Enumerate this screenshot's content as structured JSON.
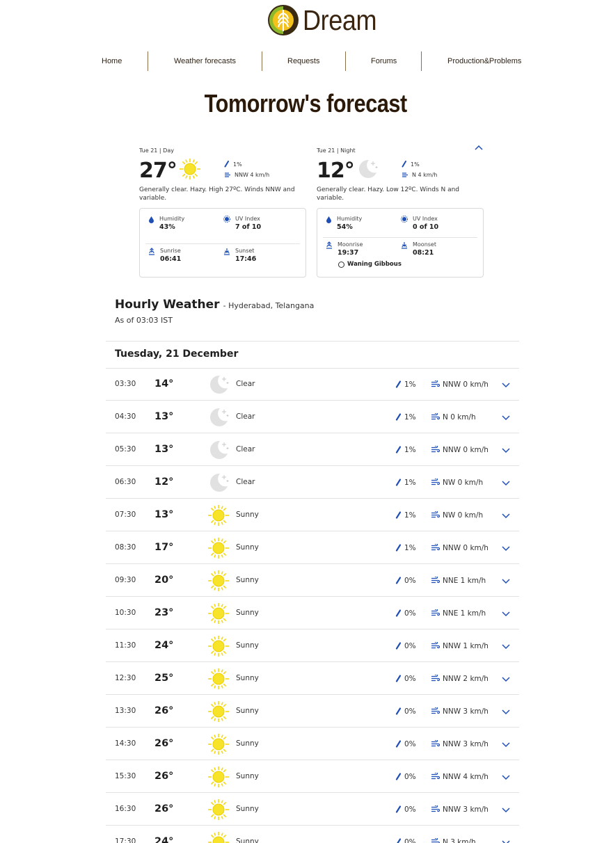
{
  "brand": {
    "name": "Dream"
  },
  "nav": {
    "items": [
      {
        "label": "Home"
      },
      {
        "label": "Weather forecasts"
      },
      {
        "label": "Requests"
      },
      {
        "label": "Forums"
      },
      {
        "label": "Production&Problems"
      }
    ]
  },
  "page": {
    "title": "Tomorrow's forecast"
  },
  "day": {
    "period": "Tue 21 | Day",
    "temp": "27°",
    "precip": "1%",
    "wind": "NNW 4 km/h",
    "description": "Generally clear. Hazy. High 27ºC. Winds NNW and variable.",
    "humidity_label": "Humidity",
    "humidity": "43%",
    "uv_label": "UV Index",
    "uv": "7 of 10",
    "sunrise_label": "Sunrise",
    "sunrise": "06:41",
    "sunset_label": "Sunset",
    "sunset": "17:46"
  },
  "night": {
    "period": "Tue 21 | Night",
    "temp": "12°",
    "precip": "1%",
    "wind": "N 4 km/h",
    "description": "Generally clear. Hazy. Low 12ºC. Winds N and variable.",
    "humidity_label": "Humidity",
    "humidity": "54%",
    "uv_label": "UV Index",
    "uv": "0 of 10",
    "moonrise_label": "Moonrise",
    "moonrise": "19:37",
    "moonset_label": "Moonset",
    "moonset": "08:21",
    "moon_phase": "Waning Gibbous"
  },
  "hourly": {
    "title": "Hourly Weather",
    "location": "- Hyderabad, Telangana",
    "as_of": "As of 03:03 IST",
    "day_label": "Tuesday, 21 December",
    "rows": [
      {
        "time": "03:30",
        "temp": "14°",
        "icon": "moon-icon",
        "condition": "Clear",
        "precip": "1%",
        "wind": "NNW 0 km/h"
      },
      {
        "time": "04:30",
        "temp": "13°",
        "icon": "moon-icon",
        "condition": "Clear",
        "precip": "1%",
        "wind": "N 0 km/h"
      },
      {
        "time": "05:30",
        "temp": "13°",
        "icon": "moon-icon",
        "condition": "Clear",
        "precip": "1%",
        "wind": "NNW 0 km/h"
      },
      {
        "time": "06:30",
        "temp": "12°",
        "icon": "moon-icon",
        "condition": "Clear",
        "precip": "1%",
        "wind": "NW 0 km/h"
      },
      {
        "time": "07:30",
        "temp": "13°",
        "icon": "sun-icon",
        "condition": "Sunny",
        "precip": "1%",
        "wind": "NW 0 km/h"
      },
      {
        "time": "08:30",
        "temp": "17°",
        "icon": "sun-icon",
        "condition": "Sunny",
        "precip": "1%",
        "wind": "NNW 0 km/h"
      },
      {
        "time": "09:30",
        "temp": "20°",
        "icon": "sun-icon",
        "condition": "Sunny",
        "precip": "0%",
        "wind": "NNE 1 km/h"
      },
      {
        "time": "10:30",
        "temp": "23°",
        "icon": "sun-icon",
        "condition": "Sunny",
        "precip": "0%",
        "wind": "NNE 1 km/h"
      },
      {
        "time": "11:30",
        "temp": "24°",
        "icon": "sun-icon",
        "condition": "Sunny",
        "precip": "0%",
        "wind": "NNW 1 km/h"
      },
      {
        "time": "12:30",
        "temp": "25°",
        "icon": "sun-icon",
        "condition": "Sunny",
        "precip": "0%",
        "wind": "NNW 2 km/h"
      },
      {
        "time": "13:30",
        "temp": "26°",
        "icon": "sun-icon",
        "condition": "Sunny",
        "precip": "0%",
        "wind": "NNW 3 km/h"
      },
      {
        "time": "14:30",
        "temp": "26°",
        "icon": "sun-icon",
        "condition": "Sunny",
        "precip": "0%",
        "wind": "NNW 3 km/h"
      },
      {
        "time": "15:30",
        "temp": "26°",
        "icon": "sun-icon",
        "condition": "Sunny",
        "precip": "0%",
        "wind": "NNW 4 km/h"
      },
      {
        "time": "16:30",
        "temp": "26°",
        "icon": "sun-icon",
        "condition": "Sunny",
        "precip": "0%",
        "wind": "NNW 3 km/h"
      },
      {
        "time": "17:30",
        "temp": "24°",
        "icon": "sun-icon",
        "condition": "Sunny",
        "precip": "0%",
        "wind": "N 3 km/h"
      }
    ]
  },
  "colors": {
    "brand_text": "#3a2510",
    "sun": "#f5d90a",
    "moon": "#d8d8d8",
    "accent_blue": "#1f4fb4"
  }
}
